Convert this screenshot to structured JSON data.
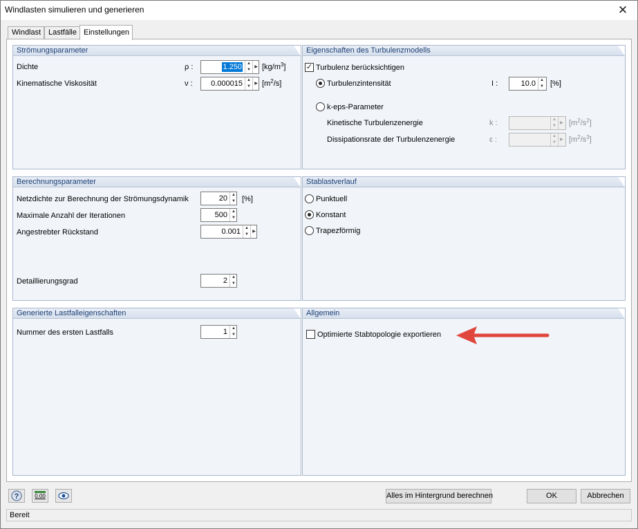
{
  "window": {
    "title": "Windlasten simulieren und generieren",
    "close_glyph": "✕"
  },
  "tabs": [
    {
      "label": "Windlast"
    },
    {
      "label": "Lastfälle"
    },
    {
      "label": "Einstellungen"
    }
  ],
  "stroemung": {
    "title": "Strömungsparameter",
    "dichte": {
      "label": "Dichte",
      "symbol": "ρ :",
      "value": "1.250",
      "unit_pre": "[kg/m",
      "unit_sup": "3",
      "unit_post": "]"
    },
    "viskositaet": {
      "label": "Kinematische Viskosität",
      "symbol": "ν :",
      "value": "0.000015",
      "unit_pre": "[m",
      "unit_sup": "2",
      "unit_post": "/s]"
    }
  },
  "turbulenz": {
    "title": "Eigenschaften des Turbulenzmodells",
    "beruecksichtigen": {
      "label": "Turbulenz berücksichtigen",
      "checked": true
    },
    "intensitaet": {
      "label": "Turbulenzintensität",
      "symbol": "I :",
      "value": "10.0",
      "unit": "[%]"
    },
    "keps": {
      "label": "k-eps-Parameter"
    },
    "kinetisch": {
      "label": "Kinetische Turbulenzenergie",
      "symbol": "k :",
      "value": "",
      "unit_pre": "[m",
      "unit_sup1": "2",
      "unit_mid": "/s",
      "unit_sup2": "2",
      "unit_post": "]"
    },
    "dissipation": {
      "label": "Dissipationsrate der Turbulenzenergie",
      "symbol": "ε :",
      "value": "",
      "unit_pre": "[m",
      "unit_sup1": "2",
      "unit_mid": "/s",
      "unit_sup2": "3",
      "unit_post": "]"
    }
  },
  "berechnung": {
    "title": "Berechnungsparameter",
    "netzdichte": {
      "label": "Netzdichte zur Berechnung der Strömungsdynamik",
      "value": "20",
      "unit": "[%]"
    },
    "iterationen": {
      "label": "Maximale Anzahl der Iterationen",
      "value": "500"
    },
    "rueckstand": {
      "label": "Angestrebter Rückstand",
      "value": "0.001"
    },
    "detaillierung": {
      "label": "Detaillierungsgrad",
      "value": "2"
    }
  },
  "stablast": {
    "title": "Stablastverlauf",
    "options": [
      {
        "label": "Punktuell",
        "selected": false
      },
      {
        "label": "Konstant",
        "selected": true
      },
      {
        "label": "Trapezförmig",
        "selected": false
      }
    ]
  },
  "lastfall": {
    "title": "Generierte Lastfalleigenschaften",
    "nummer": {
      "label": "Nummer des ersten Lastfalls",
      "value": "1"
    }
  },
  "allgemein": {
    "title": "Allgemein",
    "optimiert": {
      "label": "Optimierte Stabtopologie exportieren",
      "checked": false
    },
    "arrow_color": "#e0463c"
  },
  "footer": {
    "help_icon": "help-icon",
    "units_icon": "units-icon",
    "units_icon_text": "0.00",
    "view_icon": "eye-icon",
    "background_button": "Alles im Hintergrund berechnen",
    "ok_button": "OK",
    "cancel_button": "Abbrechen"
  },
  "status": {
    "text": "Bereit"
  },
  "colors": {
    "group_header_text": "#1a3f75",
    "group_background": "#f1f4f9",
    "selection": "#0078d7"
  }
}
